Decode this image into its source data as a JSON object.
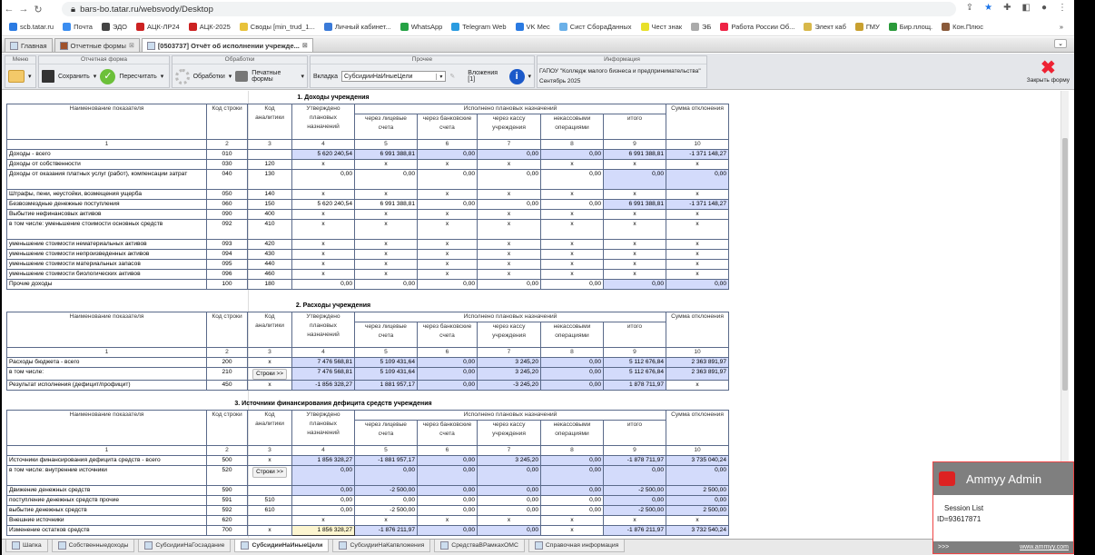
{
  "browser": {
    "url": "bars-bo.tatar.ru/websvody/Desktop",
    "bookmarks": [
      {
        "label": "scb.tatar.ru",
        "color": "#2a7ae2"
      },
      {
        "label": "Почта",
        "color": "#3b8df0"
      },
      {
        "label": "ЭДО",
        "color": "#444"
      },
      {
        "label": "АЦК-ЛР24",
        "color": "#c22"
      },
      {
        "label": "АЦК-2025",
        "color": "#c22"
      },
      {
        "label": "Своды [min_trud_1...",
        "color": "#e8c23a"
      },
      {
        "label": "Личный кабинет...",
        "color": "#3a7ad8"
      },
      {
        "label": "WhatsApp",
        "color": "#25a244"
      },
      {
        "label": "Telegram Web",
        "color": "#2a9be0"
      },
      {
        "label": "VK Mec",
        "color": "#2a7ae2"
      },
      {
        "label": "Сист СбораДанных",
        "color": "#6ab0e8"
      },
      {
        "label": "Чест знак",
        "color": "#e8e02a"
      },
      {
        "label": "ЭБ",
        "color": "#aaa"
      },
      {
        "label": "Работа России Об...",
        "color": "#e24"
      },
      {
        "label": "Элект каб",
        "color": "#d8b84a"
      },
      {
        "label": "ГМУ",
        "color": "#c8a030"
      },
      {
        "label": "Бир.площ.",
        "color": "#2a9a3a"
      },
      {
        "label": "Кон.Плюс",
        "color": "#8a5a3a"
      }
    ],
    "more": "»"
  },
  "app_tabs": [
    {
      "label": "Главная"
    },
    {
      "label": "Отчетные формы"
    },
    {
      "label": "[0503737] Отчёт об исполнении учрежде..."
    }
  ],
  "toolbar": {
    "menu_title": "Меню",
    "form_title": "Отчетная форма",
    "save": "Сохранить",
    "recalc": "Пересчитать",
    "proc_title": "Обработки",
    "proc": "Обработки",
    "print": "Печатные формы",
    "other_title": "Прочее",
    "tab_label": "Вкладка",
    "tab_value": "СубсидииНаИныеЦели",
    "attachments": "Вложения [1]",
    "info_title": "Информация",
    "org": "ГАПОУ \"Колледж малого бизнеса и предпринимательства\"",
    "period": "Сентябрь 2025",
    "close": "Закрыть форму"
  },
  "headers": {
    "name": "Наименование показателя",
    "code": "Код строки",
    "an": "Код аналитики",
    "plan": "Утверждено плановых назначений",
    "exec": "Исполнено плановых назначений",
    "c5": "через лицевые счета",
    "c6": "через банковские счета",
    "c7": "через кассу учреждения",
    "c8": "некассовыми операциями",
    "c9": "итого",
    "c10": "Сумма отклонения",
    "nums": [
      "1",
      "2",
      "3",
      "4",
      "5",
      "6",
      "7",
      "8",
      "9",
      "10"
    ]
  },
  "rows_button": "Строки >>",
  "sections": [
    {
      "title": "1. Доходы учреждения",
      "rows": [
        {
          "name": "Доходы - всего",
          "code": "010",
          "an": "",
          "v": [
            "5 620 240,54",
            "6 991 388,81",
            "0,00",
            "0,00",
            "0,00",
            "6 991 388,81",
            "-1 371 148,27"
          ],
          "hl": "bbbbbbb"
        },
        {
          "name": "Доходы от собственности",
          "code": "030",
          "an": "120",
          "v": [
            "x",
            "x",
            "x",
            "x",
            "x",
            "x",
            "x"
          ],
          "hl": "-------"
        },
        {
          "name": "Доходы от оказания платных услуг (работ), компенсации затрат",
          "code": "040",
          "an": "130",
          "v": [
            "0,00",
            "0,00",
            "0,00",
            "0,00",
            "0,00",
            "0,00",
            "0,00"
          ],
          "hl": "-----bb",
          "tall": true
        },
        {
          "name": "Штрафы, пени, неустойки, возмещения ущерба",
          "code": "050",
          "an": "140",
          "v": [
            "x",
            "x",
            "x",
            "x",
            "x",
            "x",
            "x"
          ],
          "hl": "-------"
        },
        {
          "name": "Безвозмездные денежные поступления",
          "code": "060",
          "an": "150",
          "v": [
            "5 620 240,54",
            "6 991 388,81",
            "0,00",
            "0,00",
            "0,00",
            "6 991 388,81",
            "-1 371 148,27"
          ],
          "hl": "-----bb"
        },
        {
          "name": "Выбытие нефинансовых активов",
          "code": "090",
          "an": "400",
          "v": [
            "x",
            "x",
            "x",
            "x",
            "x",
            "x",
            "x"
          ],
          "hl": "-------"
        },
        {
          "name": "в том числе: уменьшение стоимости основных средств",
          "code": "092",
          "an": "410",
          "v": [
            "x",
            "x",
            "x",
            "x",
            "x",
            "x",
            "x"
          ],
          "hl": "-------",
          "tall": true
        },
        {
          "name": "уменьшение стоимости нематериальных активов",
          "code": "093",
          "an": "420",
          "v": [
            "x",
            "x",
            "x",
            "x",
            "x",
            "x",
            "x"
          ],
          "hl": "-------"
        },
        {
          "name": "уменьшение стоимости непроизведенных активов",
          "code": "094",
          "an": "430",
          "v": [
            "x",
            "x",
            "x",
            "x",
            "x",
            "x",
            "x"
          ],
          "hl": "-------"
        },
        {
          "name": "уменьшение стоимости материальных запасов",
          "code": "095",
          "an": "440",
          "v": [
            "x",
            "x",
            "x",
            "x",
            "x",
            "x",
            "x"
          ],
          "hl": "-------"
        },
        {
          "name": "уменьшение стоимости биологических активов",
          "code": "096",
          "an": "460",
          "v": [
            "x",
            "x",
            "x",
            "x",
            "x",
            "x",
            "x"
          ],
          "hl": "-------"
        },
        {
          "name": "Прочие доходы",
          "code": "100",
          "an": "180",
          "v": [
            "0,00",
            "0,00",
            "0,00",
            "0,00",
            "0,00",
            "0,00",
            "0,00"
          ],
          "hl": "-----bb"
        }
      ]
    },
    {
      "title": "2. Расходы учреждения",
      "rows": [
        {
          "name": "Расходы бюджета - всего",
          "code": "200",
          "an": "x",
          "v": [
            "7 476 568,81",
            "5 109 431,64",
            "0,00",
            "3 245,20",
            "0,00",
            "5 112 676,84",
            "2 363 891,97"
          ],
          "hl": "bbbbbbb"
        },
        {
          "name": "в том числе:",
          "code": "210",
          "an": "",
          "btn": true,
          "v": [
            "7 476 568,81",
            "5 109 431,64",
            "0,00",
            "3 245,20",
            "0,00",
            "5 112 676,84",
            "2 363 891,97"
          ],
          "hl": "bbbbbbb"
        },
        {
          "name": "Результат исполнения (дефицит/профицит)",
          "code": "450",
          "an": "x",
          "v": [
            "-1 856 328,27",
            "1 881 957,17",
            "0,00",
            "-3 245,20",
            "0,00",
            "1 878 711,97",
            "x"
          ],
          "hl": "bbbbbb-"
        }
      ]
    },
    {
      "title": "3. Источники финансирования дефицита средств учреждения",
      "rows": [
        {
          "name": "Источники финансирования дефицита средств - всего",
          "code": "500",
          "an": "x",
          "v": [
            "1 856 328,27",
            "-1 881 957,17",
            "0,00",
            "3 245,20",
            "0,00",
            "-1 878 711,97",
            "3 735 040,24"
          ],
          "hl": "bbbbbbb"
        },
        {
          "name": "в том числе: внутренние источники",
          "code": "520",
          "an": "",
          "btn": true,
          "v": [
            "0,00",
            "0,00",
            "0,00",
            "0,00",
            "0,00",
            "0,00",
            "0,00"
          ],
          "hl": "bbbbbbb",
          "tall": true
        },
        {
          "name": "Движение денежных средств",
          "code": "590",
          "an": "",
          "v": [
            "0,00",
            "-2 500,00",
            "0,00",
            "0,00",
            "0,00",
            "-2 500,00",
            "2 500,00"
          ],
          "hl": "bbbbbbb"
        },
        {
          "name": "поступление денежных средств прочие",
          "code": "591",
          "an": "510",
          "v": [
            "0,00",
            "0,00",
            "0,00",
            "0,00",
            "0,00",
            "0,00",
            "0,00"
          ],
          "hl": "-----bb"
        },
        {
          "name": "выбытие денежных средств",
          "code": "592",
          "an": "610",
          "v": [
            "0,00",
            "-2 500,00",
            "0,00",
            "0,00",
            "0,00",
            "-2 500,00",
            "2 500,00"
          ],
          "hl": "-----bb"
        },
        {
          "name": "Внешние источники",
          "code": "620",
          "an": "",
          "v": [
            "x",
            "x",
            "x",
            "x",
            "x",
            "x",
            "x"
          ],
          "hl": "-------"
        },
        {
          "name": "Изменение остатков средств",
          "code": "700",
          "an": "x",
          "v": [
            "1 856 328,27",
            "-1 876 211,97",
            "0,00",
            "0,00",
            "x",
            "-1 876 211,97",
            "3 732 540,24"
          ],
          "hl": "ybbb-bb"
        }
      ]
    }
  ],
  "bottom_tabs": [
    {
      "label": "Шапка"
    },
    {
      "label": "Собственныедоходы"
    },
    {
      "label": "СубсидииНаГосзадание"
    },
    {
      "label": "СубсидииНаИныеЦели",
      "active": true
    },
    {
      "label": "СубсидииНаКапвложения"
    },
    {
      "label": "СредстваВРамкахОМС"
    },
    {
      "label": "Справочная информация"
    }
  ],
  "ammyy": {
    "title": "Ammyy Admin",
    "session": "Session List",
    "id": "ID=93617871",
    "more": ">>>",
    "link": "www.ammyy.com"
  },
  "colors": {
    "highlight": "#d3dbfb",
    "edited": "#fcf5cf",
    "ammyy_border": "#e44"
  }
}
